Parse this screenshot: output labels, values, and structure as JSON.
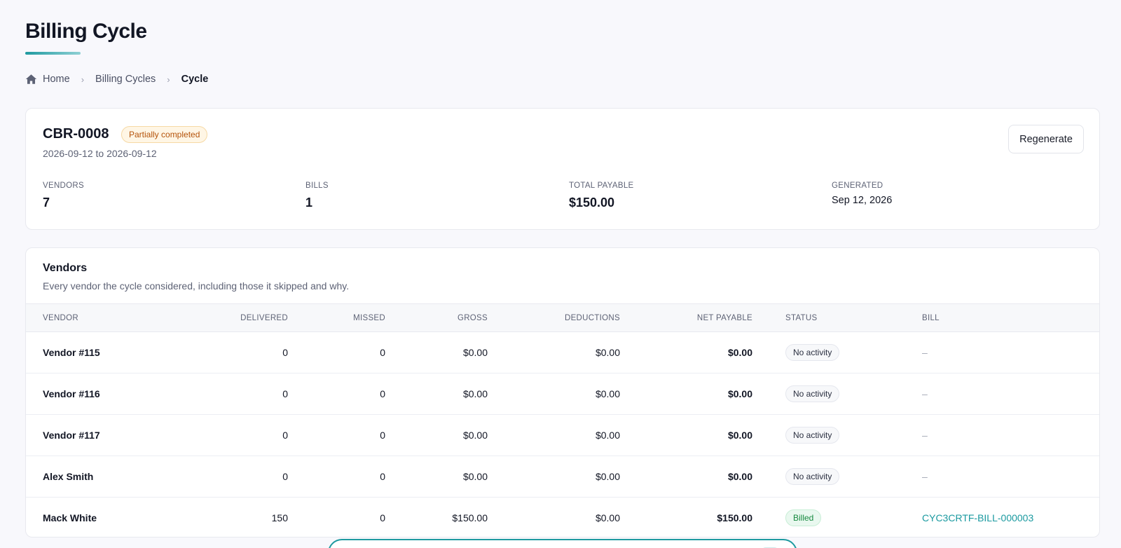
{
  "page": {
    "title": "Billing Cycle"
  },
  "breadcrumb": {
    "home": "Home",
    "section": "Billing Cycles",
    "current": "Cycle"
  },
  "summary": {
    "id": "CBR-0008",
    "status": "Partially completed",
    "date_range": "2026-09-12 to 2026-09-12",
    "regenerate_label": "Regenerate",
    "stats": {
      "vendors": {
        "label": "VENDORS",
        "value": "7"
      },
      "bills": {
        "label": "BILLS",
        "value": "1"
      },
      "total_payable": {
        "label": "TOTAL PAYABLE",
        "value": "$150.00"
      },
      "generated": {
        "label": "GENERATED",
        "value": "Sep 12, 2026"
      }
    }
  },
  "vendors_section": {
    "title": "Vendors",
    "subtitle": "Every vendor the cycle considered, including those it skipped and why.",
    "columns": [
      "VENDOR",
      "DELIVERED",
      "MISSED",
      "GROSS",
      "DEDUCTIONS",
      "NET PAYABLE",
      "STATUS",
      "BILL"
    ],
    "rows": [
      {
        "vendor": "Vendor #115",
        "delivered": "0",
        "missed": "0",
        "gross": "$0.00",
        "deductions": "$0.00",
        "net": "$0.00",
        "status": "No activity",
        "bill": "–"
      },
      {
        "vendor": "Vendor #116",
        "delivered": "0",
        "missed": "0",
        "gross": "$0.00",
        "deductions": "$0.00",
        "net": "$0.00",
        "status": "No activity",
        "bill": "–"
      },
      {
        "vendor": "Vendor #117",
        "delivered": "0",
        "missed": "0",
        "gross": "$0.00",
        "deductions": "$0.00",
        "net": "$0.00",
        "status": "No activity",
        "bill": "–"
      },
      {
        "vendor": "Alex Smith",
        "delivered": "0",
        "missed": "0",
        "gross": "$0.00",
        "deductions": "$0.00",
        "net": "$0.00",
        "status": "No activity",
        "bill": "–"
      },
      {
        "vendor": "Mack White",
        "delivered": "150",
        "missed": "0",
        "gross": "$150.00",
        "deductions": "$0.00",
        "net": "$150.00",
        "status": "Billed",
        "bill": "CYC3CRTF-BILL-000003"
      }
    ]
  },
  "colors": {
    "accent": "#1f9aa0",
    "status_partial": "#b4530a",
    "status_billed": "#16893f"
  },
  "icons": {
    "home": "home-icon",
    "separator": "chevron-right-icon"
  }
}
